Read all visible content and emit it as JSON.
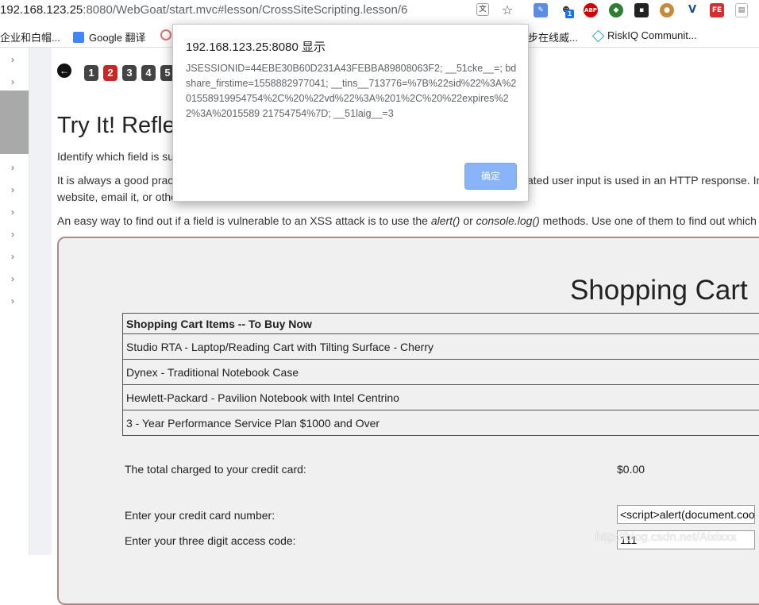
{
  "browser": {
    "url_host": "192.168.123.25",
    "url_rest": ":8080/WebGoat/start.mvc#lesson/CrossSiteScripting.lesson/6",
    "ext_badge": "1",
    "ext_abp": "ABP",
    "ext_fe": "FE"
  },
  "bookmarks": [
    {
      "label": "企业和白帽..."
    },
    {
      "label": "Google 翻译"
    },
    {
      "label": "步在线威..."
    },
    {
      "label": "RiskIQ Communit..."
    }
  ],
  "lesson": {
    "back_symbol": "←",
    "pages": [
      "1",
      "2",
      "3",
      "4",
      "5"
    ],
    "current_page": "2",
    "title": "Try It! Refle",
    "p1": "Identify which field is su",
    "p2a": "It is always a good prac",
    "p2b": "ated user input is used in an HTTP response. In",
    "p2c": "website, email it, or othe",
    "p3_pre": "An easy way to find out if a field is vulnerable to an XSS attack is to use the ",
    "p3_m1": "alert()",
    "p3_mid": " or ",
    "p3_m2": "console.log()",
    "p3_post": " methods. Use one of them to find out which"
  },
  "cart": {
    "title": "Shopping Cart",
    "header": "Shopping Cart Items -- To Buy Now",
    "items": [
      "Studio RTA - Laptop/Reading Cart with Tilting Surface - Cherry",
      "Dynex - Traditional Notebook Case",
      "Hewlett-Packard - Pavilion Notebook with Intel Centrino",
      "3 - Year Performance Service Plan $1000 and Over"
    ],
    "total_label": "The total charged to your credit card:",
    "total_value": "$0.00",
    "cc_label": "Enter your credit card number:",
    "cc_value": "<script>alert(document.coo",
    "code_label": "Enter your three digit access code:",
    "code_value": "111"
  },
  "watermark": "http://blog.csdn.net/Aixixxx",
  "dialog": {
    "title": "192.168.123.25:8080 显示",
    "message": "JSESSIONID=44EBE30B60D231A43FEBBA89808063F2; __51cke__=; bdshare_firstime=1558882977041; __tins__713776=%7B%22sid%22%3A%201558919954754%2C%20%22vd%22%3A%201%2C%20%22expires%22%3A%2015589 21754754%7D; __51laig__=3",
    "ok_label": "确定"
  }
}
